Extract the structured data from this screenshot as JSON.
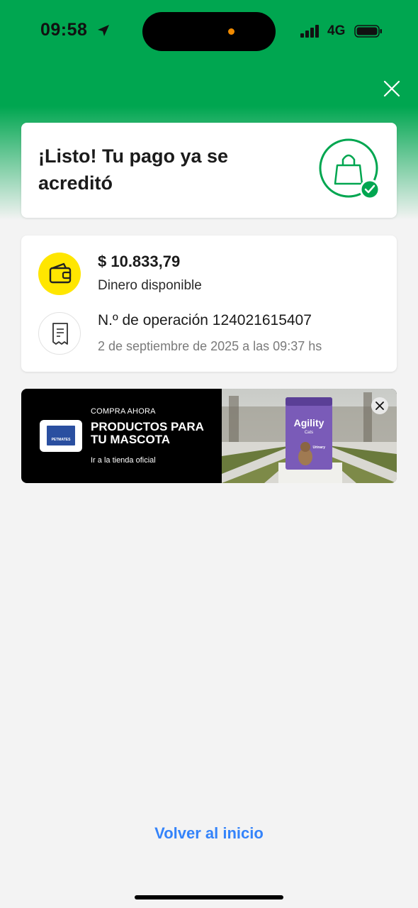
{
  "status_bar": {
    "time": "09:58",
    "network": "4G"
  },
  "success": {
    "title": "¡Listo! Tu pago ya se acreditó"
  },
  "payment": {
    "amount": "$ 10.833,79",
    "amount_label": "Dinero disponible",
    "operation": "N.º de operación 124021615407",
    "date": "2 de septiembre de 2025 a las 09:37 hs"
  },
  "banner": {
    "kicker": "COMPRA AHORA",
    "title": "PRODUCTOS PARA TU MASCOTA",
    "link": "Ir a la tienda oficial",
    "brand": "PETMATES",
    "product_brand": "Agility",
    "product_sub": "Cats",
    "product_variant": "Urinary"
  },
  "footer": {
    "home_link": "Volver al inicio"
  },
  "colors": {
    "brand_green": "#00a650",
    "wallet_yellow": "#ffe600",
    "link_blue": "#3483fa",
    "product_purple": "#7a5bb8"
  },
  "icons": [
    "location-arrow-icon",
    "signal-icon",
    "battery-icon",
    "close-icon",
    "shopping-bag-check-icon",
    "wallet-icon",
    "receipt-icon",
    "banner-close-icon"
  ]
}
